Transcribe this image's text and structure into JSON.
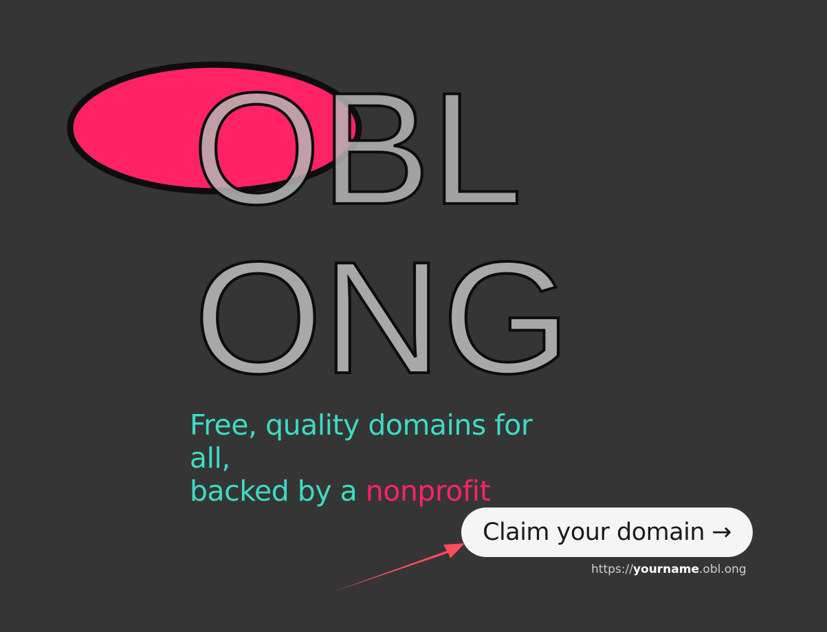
{
  "logo": {
    "line1": "OBL",
    "line2": "ONG"
  },
  "tagline": {
    "line1": "Free, quality domains for",
    "line2": "all,",
    "line3_prefix": "backed by a ",
    "line3_highlight": "nonprofit"
  },
  "cta": {
    "label": "Claim your domain",
    "arrow": "→"
  },
  "url_hint": {
    "prefix": "https://",
    "name": "yourname",
    "suffix": ".obl.ong"
  },
  "colors": {
    "background": "#353535",
    "teal": "#3ddcc4",
    "pink": "#ff2366",
    "letter_fill": "#b5b5b5",
    "button_bg": "#f5f5f5",
    "button_text": "#1a1a1a",
    "hint_text": "#cfcfcf",
    "annotation_arrow": "#ff4d5e"
  }
}
